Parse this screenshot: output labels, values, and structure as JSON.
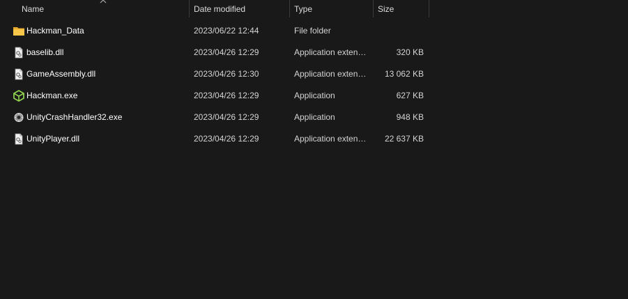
{
  "columns": {
    "name": "Name",
    "date": "Date modified",
    "type": "Type",
    "size": "Size"
  },
  "files": [
    {
      "icon": "folder-icon",
      "name": "Hackman_Data",
      "date": "2023/06/22 12:44",
      "type": "File folder",
      "size": ""
    },
    {
      "icon": "dll-file-icon",
      "name": "baselib.dll",
      "date": "2023/04/26 12:29",
      "type": "Application exten…",
      "size": "320 KB"
    },
    {
      "icon": "dll-file-icon",
      "name": "GameAssembly.dll",
      "date": "2023/04/26 12:30",
      "type": "Application exten…",
      "size": "13 062 KB"
    },
    {
      "icon": "unity-cube-icon",
      "name": "Hackman.exe",
      "date": "2023/04/26 12:29",
      "type": "Application",
      "size": "627 KB"
    },
    {
      "icon": "crash-handler-icon",
      "name": "UnityCrashHandler32.exe",
      "date": "2023/04/26 12:29",
      "type": "Application",
      "size": "948 KB"
    },
    {
      "icon": "dll-file-icon",
      "name": "UnityPlayer.dll",
      "date": "2023/04/26 12:29",
      "type": "Application exten…",
      "size": "22 637 KB"
    }
  ],
  "colors": {
    "background": "#191919",
    "folder": "#f6c343",
    "unity_green": "#8fd14f"
  }
}
